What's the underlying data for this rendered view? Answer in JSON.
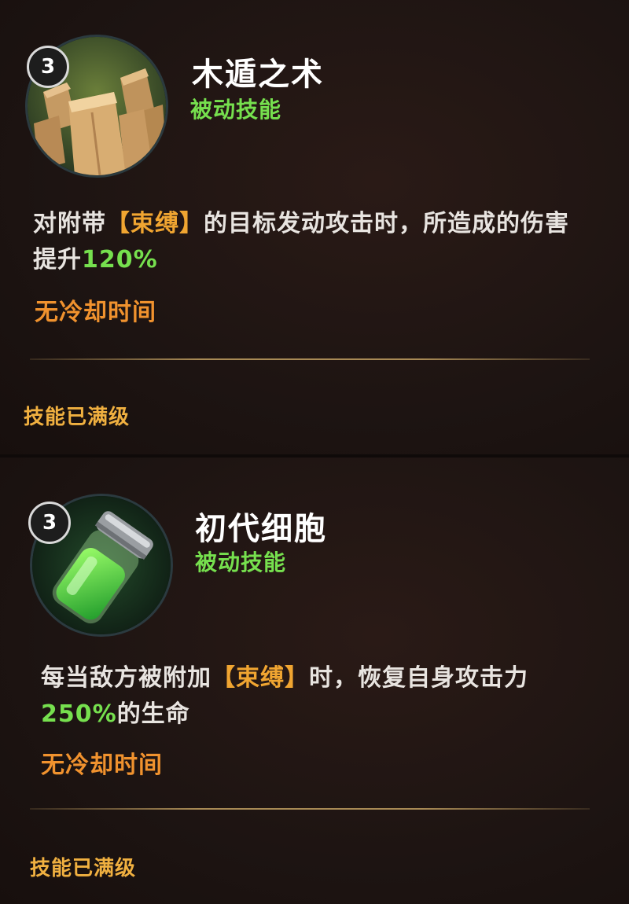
{
  "skills": [
    {
      "level": "3",
      "icon": "wood-pillars-icon",
      "name": "木遁之术",
      "type": "被动技能",
      "desc": {
        "prefix": "对附带",
        "keyword": "【束缚】",
        "middle": "的目标发动攻击时，所造成的伤害提升",
        "percent": "120%",
        "suffix": ""
      },
      "cooldown": "无冷却时间",
      "status": "技能已满级"
    },
    {
      "level": "3",
      "icon": "green-cell-vial-icon",
      "name": "初代细胞",
      "type": "被动技能",
      "desc": {
        "prefix": "每当敌方被附加",
        "keyword": "【束缚】",
        "middle": "时，恢复自身攻击力",
        "percent": "250%",
        "suffix": "的生命"
      },
      "cooldown": "无冷却时间",
      "status": "技能已满级"
    }
  ],
  "colors": {
    "skill_type": "#76e04e",
    "keyword": "#f0a531",
    "cooldown": "#f0922e",
    "maxed": "#f0b040"
  }
}
